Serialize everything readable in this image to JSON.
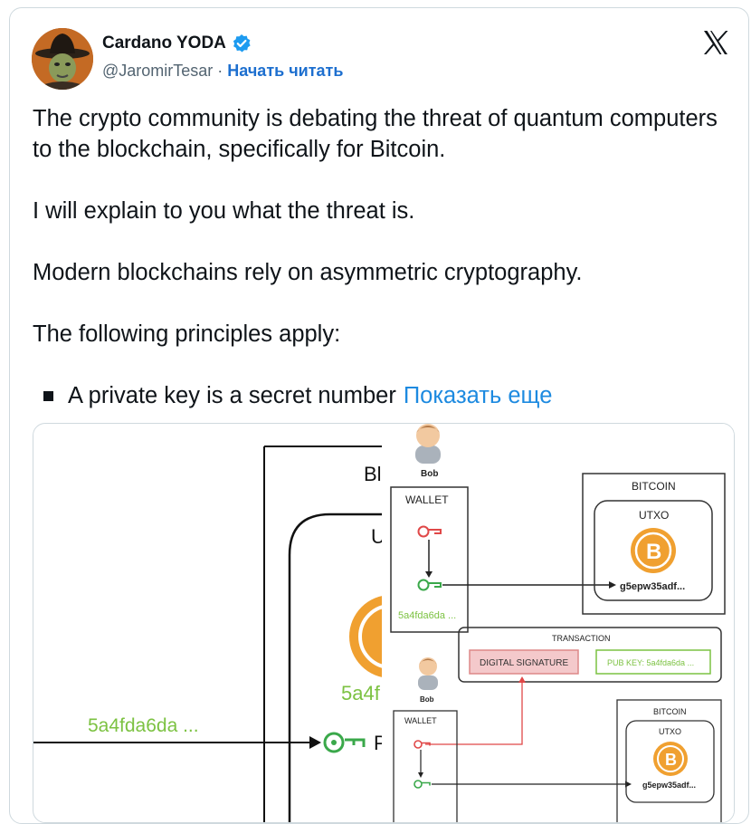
{
  "author": {
    "display_name": "Cardano YODA",
    "handle": "@JaromirTesar",
    "separator": "·",
    "follow_label": "Начать читать"
  },
  "tweet": {
    "paragraphs": [
      "The crypto community is debating the threat of quantum computers to the blockchain, specifically for Bitcoin.",
      "I will explain to you what the threat is.",
      "Modern blockchains rely on asymmetric cryptography.",
      "The following principles apply:"
    ],
    "bullet_text": "A private key is a secret number",
    "show_more_label": "Показать еще"
  },
  "media": {
    "back_image": {
      "label_bl": "Bl",
      "label_u": "U",
      "pubkey_large": "5a4f",
      "pubkey_left": "5a4fda6da ...",
      "label_p": "P"
    },
    "front_diagram": {
      "bob_label": "Bob",
      "wallet_label": "WALLET",
      "pubkey_small": "5a4fda6da ...",
      "bitcoin_label": "BITCOIN",
      "utxo_label": "UTXO",
      "utxo_address": "g5epw35adf...",
      "transaction_label": "TRANSACTION",
      "digital_signature_label": "DIGITAL SIGNATURE",
      "pub_key_label": "PUB KEY: 5a4fda6da ...",
      "bob_label_2": "Bob",
      "wallet_label_2": "WALLET",
      "bitcoin_label_2": "BITCOIN",
      "utxo_label_2": "UTXO",
      "utxo_address_2": "g5epw35adf..."
    }
  },
  "colors": {
    "link": "#1d6fcf",
    "show_more": "#1d8ae0",
    "verified": "#1d9bf0",
    "bitcoin_orange": "#f0a030",
    "key_red": "#e04848",
    "key_green": "#3aa84a",
    "pubkey_green": "#7cc242"
  },
  "icons": [
    "avatar",
    "verified-badge-icon",
    "x-logo-icon",
    "bob-user-icon",
    "private-key-icon",
    "public-key-icon",
    "bitcoin-icon"
  ]
}
